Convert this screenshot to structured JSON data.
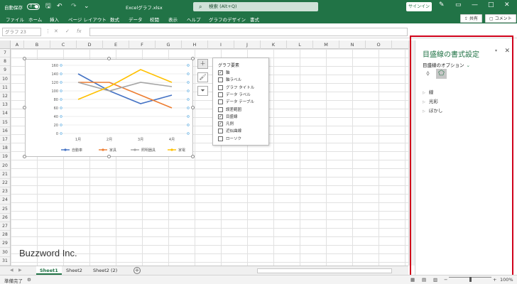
{
  "title_bar": {
    "autosave_label": "自動保存",
    "autosave_state": "オフ",
    "filename": "Excelグラフ.xlsx",
    "search_placeholder": "検索 (Alt+Q)",
    "signin_label": "サインイン"
  },
  "ribbon": {
    "tabs": [
      "ファイル",
      "ホーム",
      "挿入",
      "ページ レイアウト",
      "数式",
      "データ",
      "校閲",
      "表示",
      "ヘルプ",
      "グラフのデザイン",
      "書式"
    ],
    "active_tab_index": 9,
    "share_label": "共有",
    "comment_label": "コメント"
  },
  "formula_bar": {
    "name_box": "グラフ 23",
    "fx_label": "fx"
  },
  "columns": [
    "A",
    "B",
    "C",
    "D",
    "E",
    "F",
    "G",
    "H",
    "I",
    "J",
    "K",
    "L",
    "M",
    "N",
    "O"
  ],
  "rows": [
    "7",
    "8",
    "9",
    "10",
    "11",
    "12",
    "13",
    "14",
    "15",
    "16",
    "17",
    "18",
    "19",
    "20",
    "21",
    "22",
    "23",
    "24",
    "25",
    "26",
    "27",
    "28",
    "29",
    "30",
    "31"
  ],
  "chart_data": {
    "type": "line",
    "categories": [
      "1月",
      "2月",
      "3月",
      "4月"
    ],
    "ylim": [
      0,
      160
    ],
    "yticks": [
      "0",
      "20",
      "40",
      "60",
      "80",
      "100",
      "120",
      "140",
      "160"
    ],
    "series": [
      {
        "name": "自動車",
        "color": "#4472c4",
        "values": [
          140,
          100,
          70,
          90
        ]
      },
      {
        "name": "家具",
        "color": "#ed7d31",
        "values": [
          120,
          120,
          90,
          60
        ]
      },
      {
        "name": "照明器具",
        "color": "#a5a5a5",
        "values": [
          120,
          100,
          120,
          110
        ]
      },
      {
        "name": "家電",
        "color": "#ffc000",
        "values": [
          80,
          110,
          150,
          120
        ]
      }
    ]
  },
  "chart_elements_popup": {
    "title": "グラフ要素",
    "items": [
      {
        "label": "軸",
        "checked": true
      },
      {
        "label": "軸ラベル",
        "checked": false
      },
      {
        "label": "グラフ タイトル",
        "checked": false
      },
      {
        "label": "データ ラベル",
        "checked": false
      },
      {
        "label": "データ テーブル",
        "checked": false
      },
      {
        "label": "誤差範囲",
        "checked": false
      },
      {
        "label": "目盛線",
        "checked": true
      },
      {
        "label": "凡例",
        "checked": true
      },
      {
        "label": "近似曲線",
        "checked": false
      },
      {
        "label": "ローソク",
        "checked": false
      }
    ]
  },
  "format_panel": {
    "title": "目盛線の書式設定",
    "options_label": "目盛線のオプション",
    "sections": [
      "線",
      "光彩",
      "ぼかし"
    ]
  },
  "watermark": "Buzzword Inc.",
  "sheets": {
    "tabs": [
      "Sheet1",
      "Sheet2",
      "Sheet2 (2)"
    ],
    "active_index": 0
  },
  "status_bar": {
    "ready": "準備完了",
    "zoom": "100%"
  }
}
